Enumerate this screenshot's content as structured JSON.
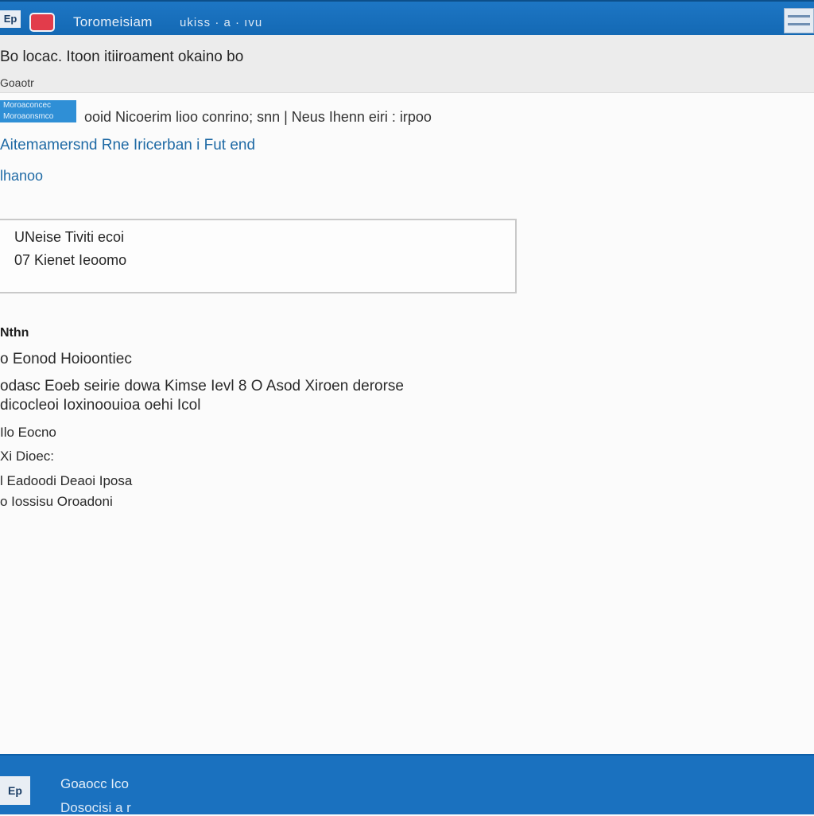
{
  "titlebar": {
    "app_icon": "Ep",
    "title": "Toromeisiam",
    "extra": "ukiss · a · ıvu"
  },
  "header": {
    "title": "Bo locac. Itoon itiiroament okaino bo",
    "subtitle": "Goaotr"
  },
  "content": {
    "badge": "Moroaconcec Moroaonsmco",
    "info_line": "ooid Nicoerim lioo conrino; snn | Neus Ihenn eiri : irpoo",
    "link_main": "Aitemamersnd Rne Iricerban i Fut end",
    "link_small": "lhanoo"
  },
  "panel": {
    "line1": "UNeise Tiviti ecoi",
    "line2": "07 Kienet Ieoomo"
  },
  "section": {
    "heading": "Nthn",
    "rows": [
      "o Eonod Hoioontiec",
      "odasc Eoeb seirie dowa Kimse Ievl 8 O Asod Xiroen derorse",
      "dicocleoi Ioxinoouioa oehi Icol",
      "Ilo Eocno",
      "Xi Dioec:",
      "l Eadoodi Deaoi Iposa",
      "o Iossisu Oroadoni"
    ]
  },
  "taskbar": {
    "icon": "Ep",
    "line1": "Goaocc Ico",
    "line2": "Dosocisi a r"
  },
  "colors": {
    "accent": "#1d76c4",
    "record": "#e23c4b",
    "link": "#1f6aa5",
    "badge": "#2f8fd6"
  }
}
